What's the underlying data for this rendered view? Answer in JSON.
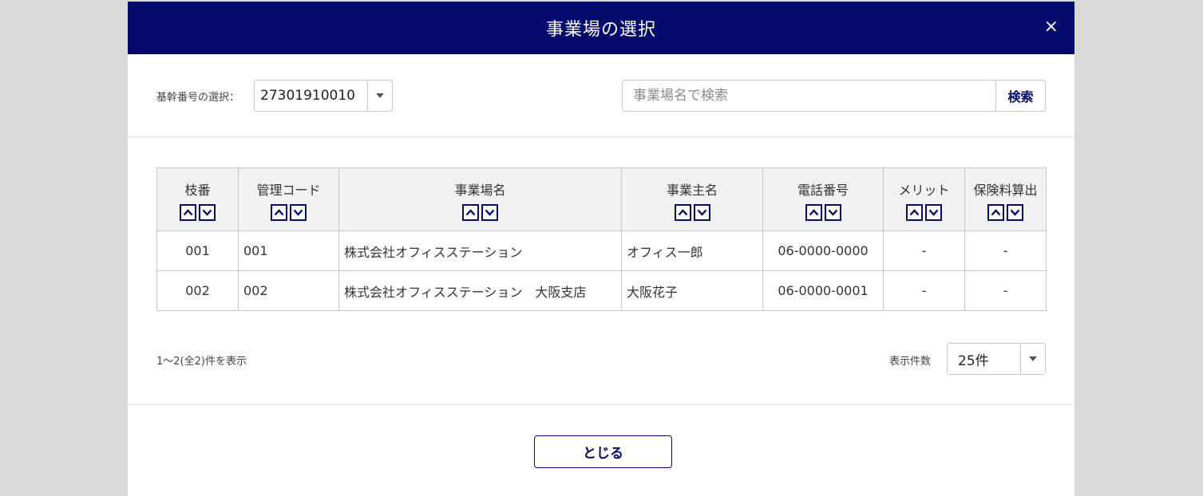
{
  "modal": {
    "title": "事業場の選択",
    "close_symbol": "×"
  },
  "filter": {
    "kikan_label": "基幹番号の選択：",
    "kikan_value": "27301910010",
    "search_placeholder": "事業場名で検索",
    "search_button": "検索"
  },
  "table": {
    "headers": [
      "枝番",
      "管理コード",
      "事業場名",
      "事業主名",
      "電話番号",
      "メリット",
      "保険料算出"
    ],
    "rows": [
      [
        "001",
        "001",
        "株式会社オフィスステーション",
        "オフィス一郎",
        "06-0000-0000",
        "-",
        "-"
      ],
      [
        "002",
        "002",
        "株式会社オフィスステーション　大阪支店",
        "大阪花子",
        "06-0000-0001",
        "-",
        "-"
      ]
    ]
  },
  "pager": {
    "count_text": "1〜2(全2)件を表示",
    "per_page_label": "表示件数",
    "per_page_value": "25件"
  },
  "footer": {
    "close_button": "とじる"
  },
  "colors": {
    "header_bg": "#050a6e",
    "accent": "#050a6e",
    "backdrop": "#d9d9d9"
  },
  "icons": {
    "sort_up": "chevron-up-icon",
    "sort_down": "chevron-down-icon",
    "dropdown": "caret-down-icon",
    "close": "close-icon"
  }
}
